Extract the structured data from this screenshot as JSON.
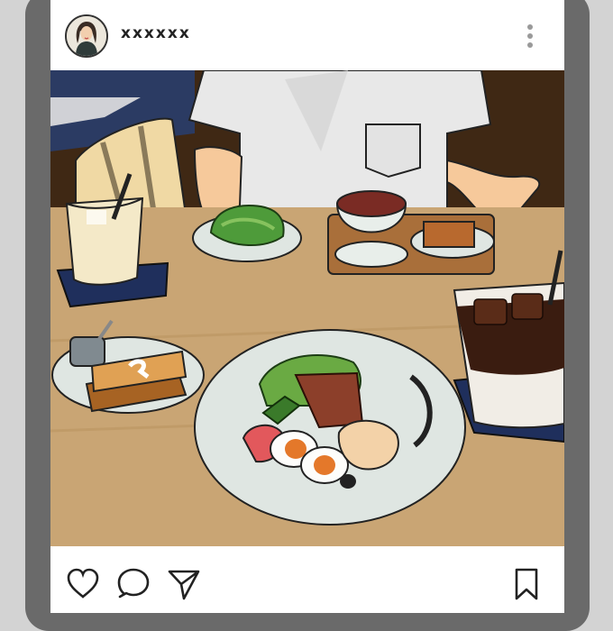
{
  "post": {
    "username": "xxxxxx",
    "avatar_icon": "profile-avatar-woman",
    "menu_icon": "more-vertical-icon"
  },
  "actions": {
    "like_icon": "heart-icon",
    "comment_icon": "comment-icon",
    "share_icon": "send-icon",
    "save_icon": "bookmark-icon"
  },
  "colors": {
    "frame": "#6a6a6a",
    "background": "#d3d3d3",
    "table": "#c9a574"
  }
}
